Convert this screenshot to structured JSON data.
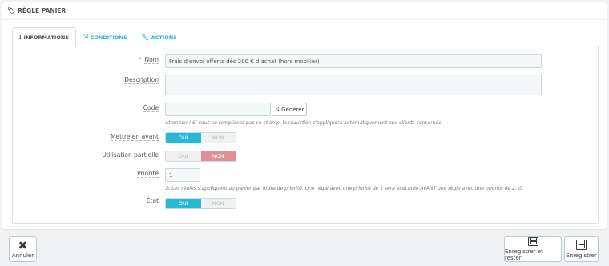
{
  "panel": {
    "title": "RÈGLE PANIER",
    "icon": "tag-icon"
  },
  "tabs": [
    {
      "label": "INFORMATIONS",
      "icon": "info-icon",
      "active": true
    },
    {
      "label": "CONDITIONS",
      "icon": "shuffle-icon",
      "active": false
    },
    {
      "label": "ACTIONS",
      "icon": "wrench-icon",
      "active": false
    }
  ],
  "form": {
    "name": {
      "label": "Nom",
      "required_mark": "*",
      "value": "Frais d'envoi offerts dès 200 € d'achat (hors mobilier)"
    },
    "description": {
      "label": "Description",
      "value": ""
    },
    "code": {
      "label": "Code",
      "value": "",
      "generate_label": "Générer",
      "help": "Attention ! Si vous ne remplissez pas ce champ, la réduction s'appliquera automatiquement aux clients concernés."
    },
    "highlight": {
      "label": "Mettre en avant",
      "yes": "OUI",
      "no": "NON",
      "value": "OUI"
    },
    "partial_use": {
      "label": "Utilisation partielle",
      "yes": "OUI",
      "no": "NON",
      "value": "NON"
    },
    "priority": {
      "label": "Priorité",
      "value": "1",
      "help": "Les règles s'appliquent au panier par ordre de priorité. Une règle avec une priorité de 1 sera exécutée AVANT une règle avec une priorité de 2."
    },
    "status": {
      "label": "État",
      "yes": "OUI",
      "no": "NON",
      "value": "OUI"
    }
  },
  "footer": {
    "cancel": "Annuler",
    "save_and_stay": "Enregistrer et rester",
    "save": "Enregistrer"
  },
  "colors": {
    "accent": "#25b9d7",
    "danger": "#e08f95"
  }
}
